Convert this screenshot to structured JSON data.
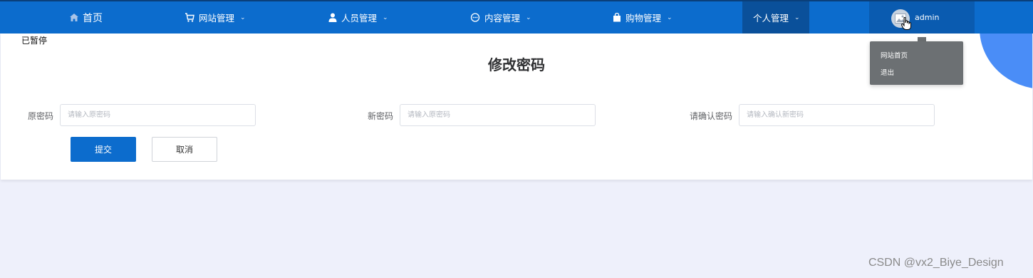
{
  "nav": {
    "home": "首页",
    "website": "网站管理",
    "personnel": "人员管理",
    "content": "内容管理",
    "shopping": "购物管理",
    "personal": "个人管理",
    "user": "admin"
  },
  "icons": {
    "home": "home-icon",
    "website": "shop-cart-icon",
    "personnel": "person-icon",
    "content": "chat-icon",
    "shopping": "bag-icon",
    "chevron": "chevron-down-icon",
    "avatar": "image-placeholder-icon",
    "cursor": "hand-pointer-icon"
  },
  "dropdown": {
    "items": [
      "网站首页",
      "退出"
    ]
  },
  "overlay": {
    "paused": "已暂停"
  },
  "page": {
    "title": "修改密码",
    "fields": [
      {
        "label": "原密码",
        "placeholder": "请输入原密码",
        "value": ""
      },
      {
        "label": "新密码",
        "placeholder": "请输入原密码",
        "value": ""
      },
      {
        "label": "请确认密码",
        "placeholder": "请输入确认新密码",
        "value": ""
      }
    ],
    "submit": "提交",
    "cancel": "取消"
  },
  "watermark": "CSDN @vx2_Biye_Design",
  "colors": {
    "primary": "#0c6ccd",
    "nav_active": "#0a509a",
    "background": "#eef0fb",
    "accent_blob": "#4a8df7",
    "dropdown": "#6c7073"
  }
}
